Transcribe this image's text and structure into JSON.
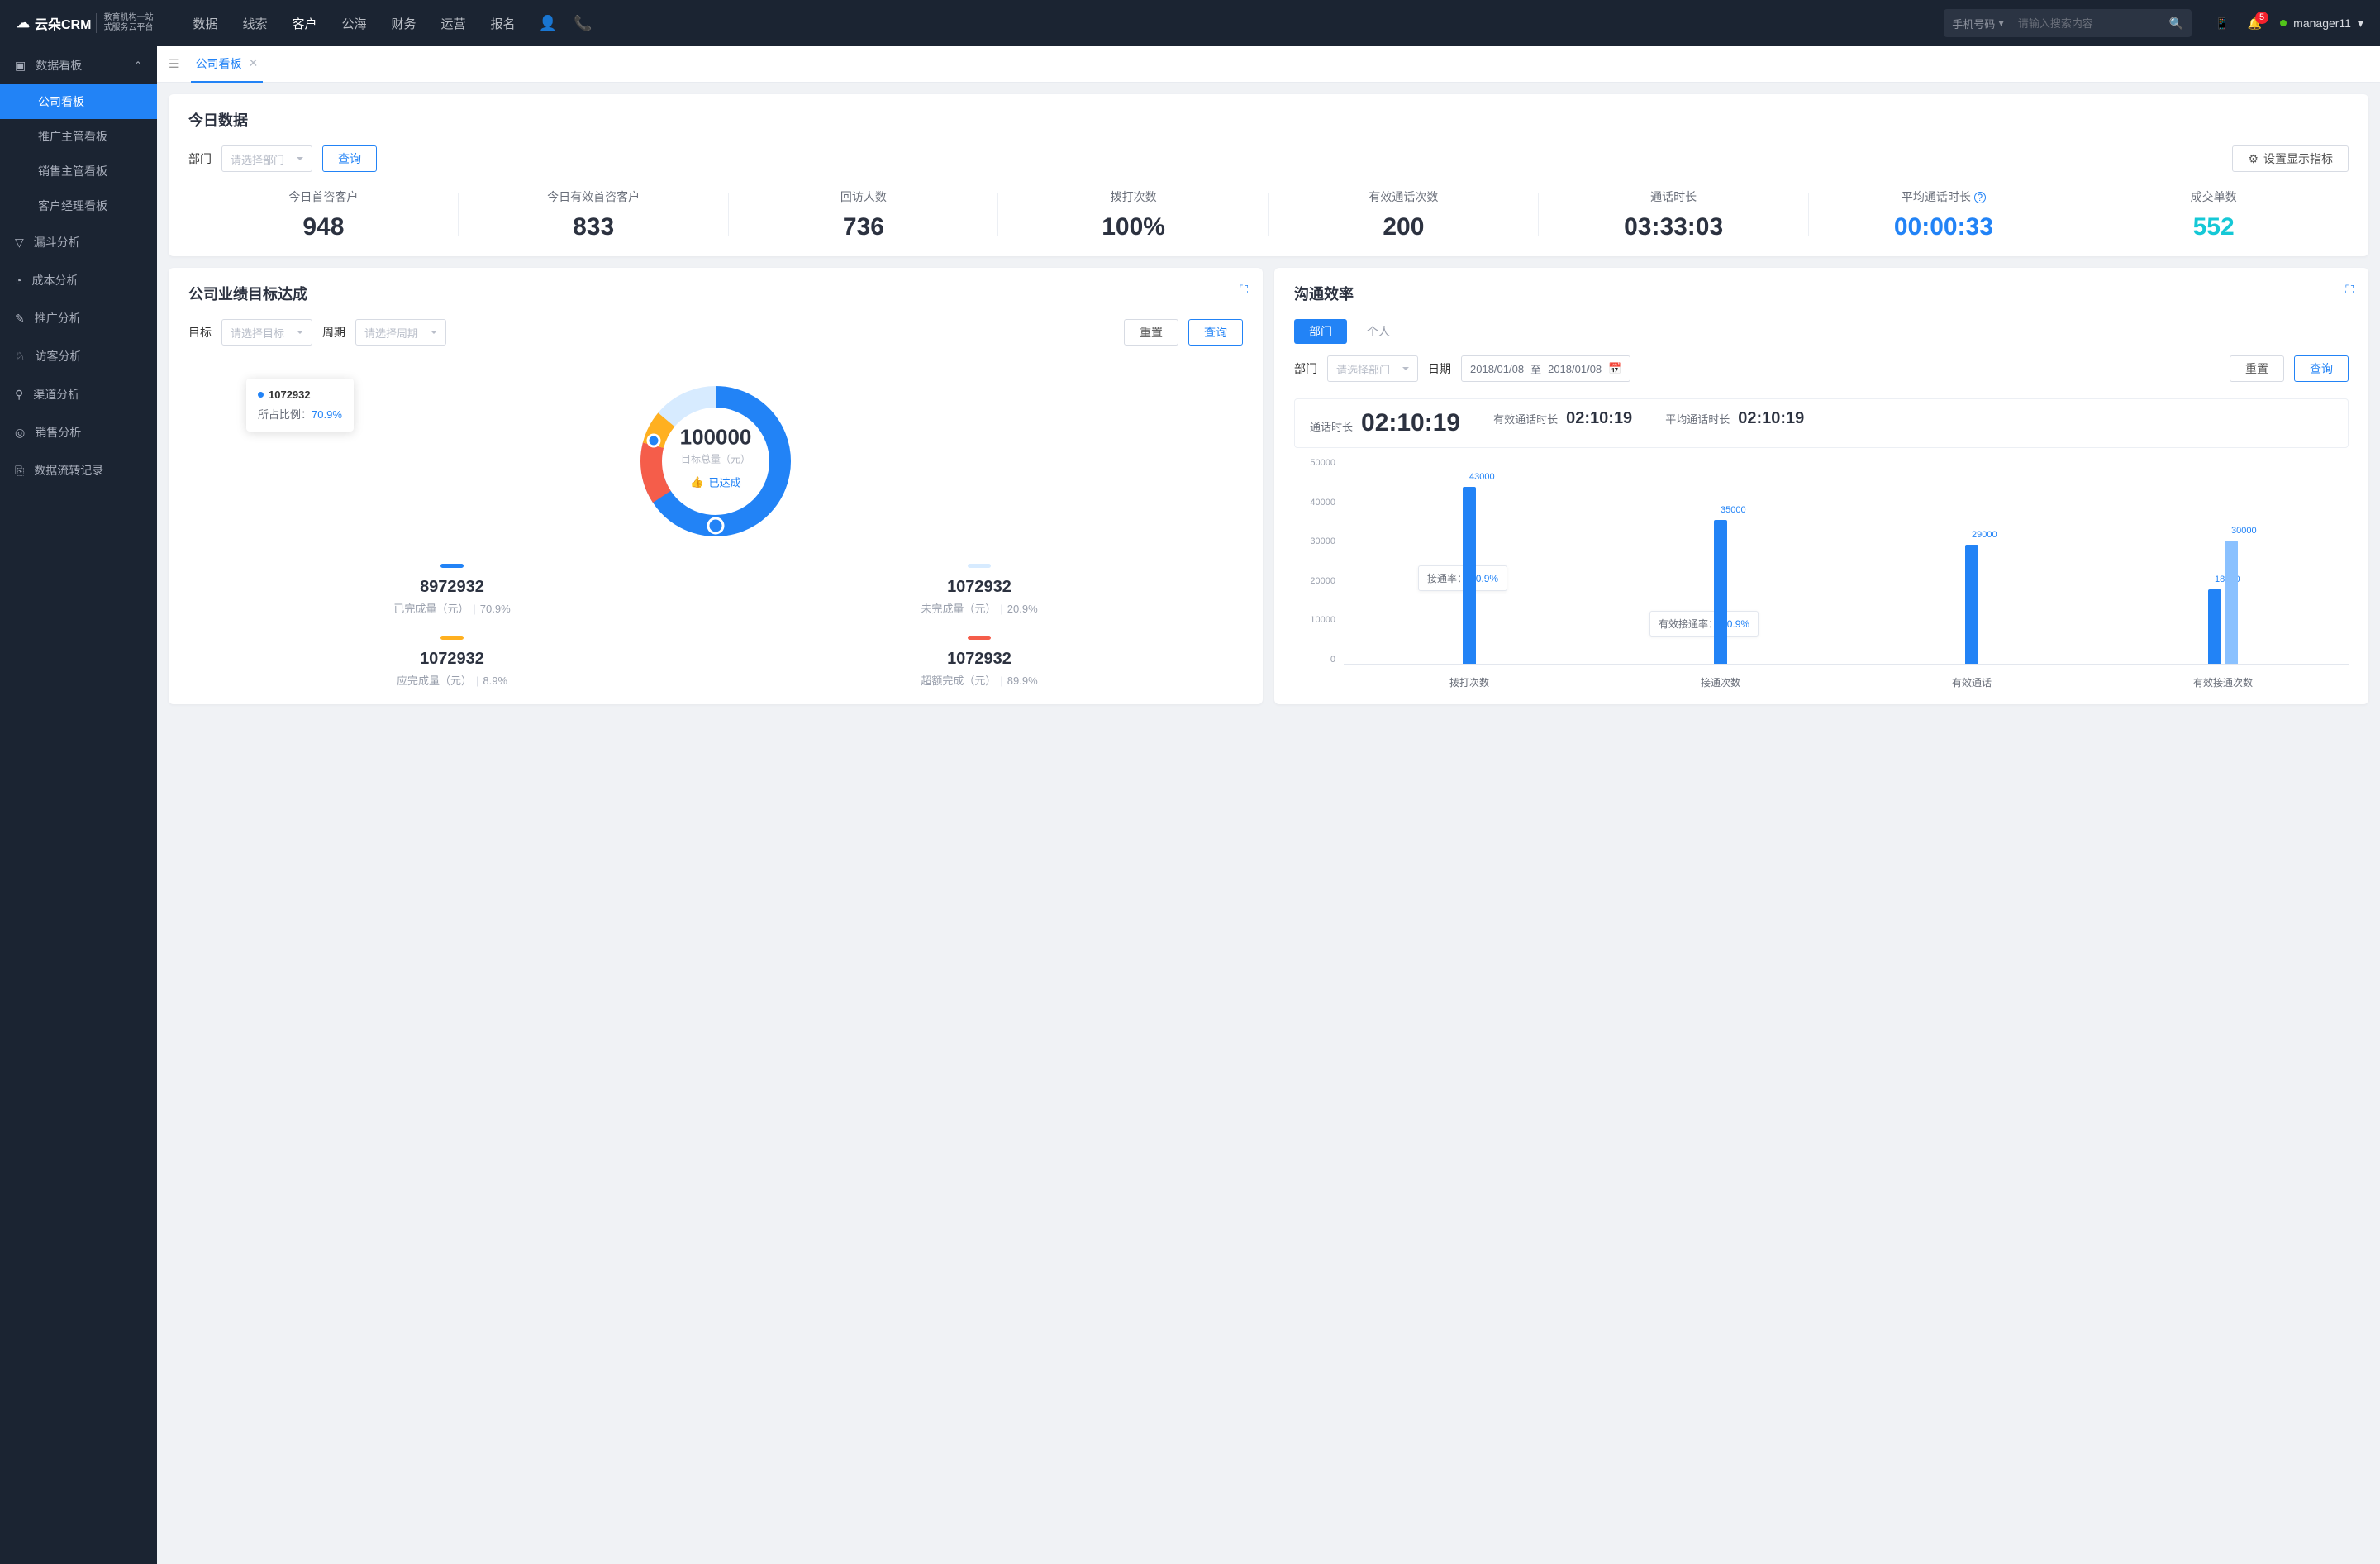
{
  "header": {
    "brand": "云朵CRM",
    "brand_sub_l1": "教育机构一站",
    "brand_sub_l2": "式服务云平台",
    "nav": [
      "数据",
      "线索",
      "客户",
      "公海",
      "财务",
      "运营",
      "报名"
    ],
    "nav_active_index": 2,
    "search_type": "手机号码",
    "search_placeholder": "请输入搜索内容",
    "badge_count": "5",
    "username": "manager11"
  },
  "sidebar": {
    "group_label": "数据看板",
    "subs": [
      "公司看板",
      "推广主管看板",
      "销售主管看板",
      "客户经理看板"
    ],
    "sub_active_index": 0,
    "items": [
      {
        "icon": "funnel",
        "label": "漏斗分析"
      },
      {
        "icon": "clock",
        "label": "成本分析"
      },
      {
        "icon": "note",
        "label": "推广分析"
      },
      {
        "icon": "visitor",
        "label": "访客分析"
      },
      {
        "icon": "channel",
        "label": "渠道分析"
      },
      {
        "icon": "sales",
        "label": "销售分析"
      },
      {
        "icon": "flow",
        "label": "数据流转记录"
      }
    ]
  },
  "tabbar": {
    "tab_label": "公司看板"
  },
  "today": {
    "title": "今日数据",
    "dept_label": "部门",
    "dept_placeholder": "请选择部门",
    "query_btn": "查询",
    "settings_btn": "设置显示指标",
    "metrics": [
      {
        "label": "今日首咨客户",
        "value": "948",
        "cls": ""
      },
      {
        "label": "今日有效首咨客户",
        "value": "833",
        "cls": ""
      },
      {
        "label": "回访人数",
        "value": "736",
        "cls": ""
      },
      {
        "label": "拨打次数",
        "value": "100%",
        "cls": ""
      },
      {
        "label": "有效通话次数",
        "value": "200",
        "cls": ""
      },
      {
        "label": "通话时长",
        "value": "03:33:03",
        "cls": ""
      },
      {
        "label": "平均通话时长",
        "value": "00:00:33",
        "cls": "blue",
        "info": true
      },
      {
        "label": "成交单数",
        "value": "552",
        "cls": "cyan"
      }
    ]
  },
  "goal": {
    "title": "公司业绩目标达成",
    "target_label": "目标",
    "target_placeholder": "请选择目标",
    "period_label": "周期",
    "period_placeholder": "请选择周期",
    "reset_btn": "重置",
    "query_btn": "查询",
    "tooltip_value": "1072932",
    "tooltip_ratio_label": "所占比例：",
    "tooltip_ratio": "70.9%",
    "center_value": "100000",
    "center_sub": "目标总量（元）",
    "center_status": "已达成",
    "legends": [
      {
        "color": "#2283f6",
        "value": "8972932",
        "label": "已完成量（元）",
        "pct": "70.9%"
      },
      {
        "color": "#d7ebff",
        "value": "1072932",
        "label": "未完成量（元）",
        "pct": "20.9%"
      },
      {
        "color": "#ffb020",
        "value": "1072932",
        "label": "应完成量（元）",
        "pct": "8.9%"
      },
      {
        "color": "#f55d4a",
        "value": "1072932",
        "label": "超额完成（元）",
        "pct": "89.9%"
      }
    ]
  },
  "comm": {
    "title": "沟通效率",
    "seg_tabs": [
      "部门",
      "个人"
    ],
    "seg_active": 0,
    "dept_label": "部门",
    "dept_placeholder": "请选择部门",
    "date_label": "日期",
    "date_from": "2018/01/08",
    "date_to_sep": "至",
    "date_to": "2018/01/08",
    "reset_btn": "重置",
    "query_btn": "查询",
    "kpis": [
      {
        "label": "通话时长",
        "value": "02:10:19",
        "big": true
      },
      {
        "label": "有效通话时长",
        "value": "02:10:19"
      },
      {
        "label": "平均通话时长",
        "value": "02:10:19"
      }
    ],
    "annot1_label": "接通率：",
    "annot1_val": "70.9%",
    "annot2_label": "有效接通率：",
    "annot2_val": "70.9%"
  },
  "chart_data": [
    {
      "type": "donut",
      "title": "公司业绩目标达成",
      "center_label": "目标总量（元）",
      "center_value": 100000,
      "series": [
        {
          "name": "已完成量",
          "value": 8972932,
          "pct": 70.9,
          "color": "#2283f6"
        },
        {
          "name": "未完成量",
          "value": 1072932,
          "pct": 20.9,
          "color": "#d7ebff"
        },
        {
          "name": "应完成量",
          "value": 1072932,
          "pct": 8.9,
          "color": "#ffb020"
        },
        {
          "name": "超额完成",
          "value": 1072932,
          "pct": 89.9,
          "color": "#f55d4a"
        }
      ]
    },
    {
      "type": "bar",
      "title": "沟通效率",
      "categories": [
        "拨打次数",
        "接通次数",
        "有效通话",
        "有效接通次数"
      ],
      "series": [
        {
          "name": "s1",
          "color": "#2283f6",
          "values": [
            43000,
            35000,
            29000,
            18000
          ]
        },
        {
          "name": "s2",
          "color": "#8ac1ff",
          "values": [
            null,
            null,
            null,
            30000
          ]
        }
      ],
      "ylim": [
        0,
        50000
      ],
      "yticks": [
        0,
        10000,
        20000,
        30000,
        40000,
        50000
      ],
      "annotations": [
        {
          "label": "接通率",
          "value": "70.9%"
        },
        {
          "label": "有效接通率",
          "value": "70.9%"
        }
      ]
    }
  ]
}
